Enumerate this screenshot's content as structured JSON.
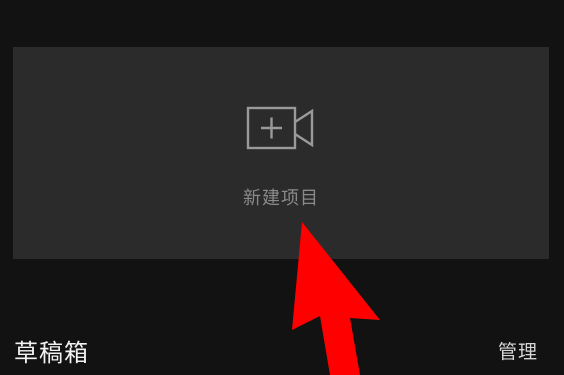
{
  "new_project": {
    "label": "新建项目",
    "icon": "add-video-icon"
  },
  "drafts": {
    "title": "草稿箱",
    "manage_label": "管理"
  },
  "annotation": {
    "icon": "red-arrow-icon",
    "color": "#ff0000"
  },
  "colors": {
    "background": "#121212",
    "card": "#2b2b2b",
    "icon_stroke": "#9a9a9a",
    "label": "#8a8a8a",
    "title": "#f2f2f2"
  }
}
